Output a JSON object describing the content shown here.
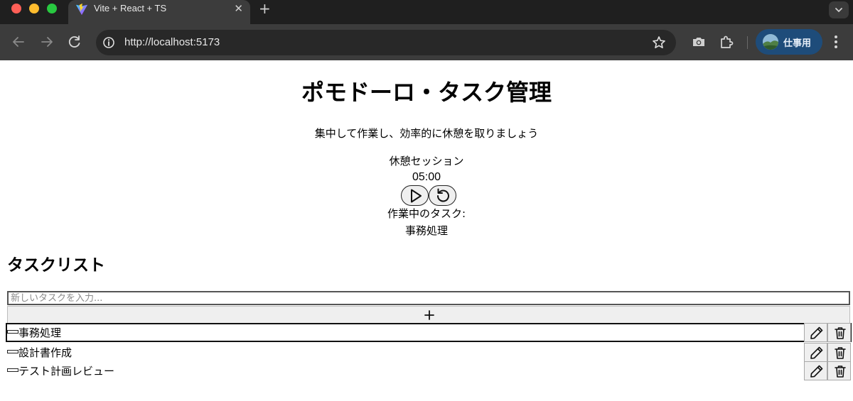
{
  "browser": {
    "tab_title": "Vite + React + TS",
    "url": "http://localhost:5173",
    "profile_label": "仕事用"
  },
  "app": {
    "title": "ポモドーロ・タスク管理",
    "subtitle": "集中して作業し、効率的に休憩を取りましょう",
    "timer": {
      "session_label": "休憩セッション",
      "time": "05:00"
    },
    "current_task": {
      "label": "作業中のタスク:",
      "name": "事務処理"
    },
    "task_list": {
      "heading": "タスクリスト",
      "input_placeholder": "新しいタスクを入力...",
      "tasks": [
        {
          "name": "事務処理",
          "active": true
        },
        {
          "name": "設計書作成",
          "active": false
        },
        {
          "name": "テスト計画レビュー",
          "active": false
        }
      ]
    }
  },
  "icons": {
    "favicon": "vite-logo-icon",
    "play": "play-icon",
    "reset": "rotate-ccw-icon",
    "add": "plus-icon",
    "edit": "pencil-icon",
    "delete": "trash-icon"
  },
  "colors": {
    "chrome_dark": "#1f1f1f",
    "toolbar": "#3c3c3c",
    "profile_chip": "#1e4c7a",
    "button_bg": "#efefef"
  }
}
